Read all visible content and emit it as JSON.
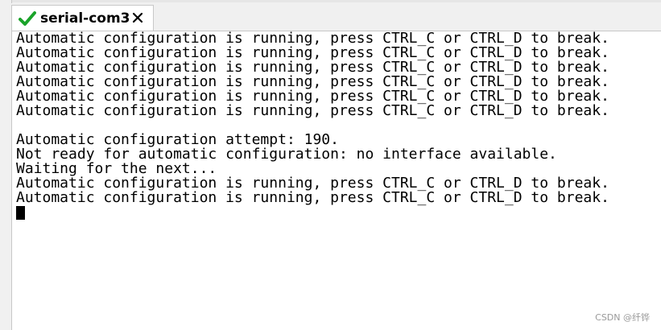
{
  "tab": {
    "title": "serial-com3",
    "status_icon": "check-icon",
    "close_icon": "close-icon",
    "status_color": "#1aa32a"
  },
  "terminal": {
    "lines": [
      "Automatic configuration is running, press CTRL_C or CTRL_D to break.",
      "Automatic configuration is running, press CTRL_C or CTRL_D to break.",
      "Automatic configuration is running, press CTRL_C or CTRL_D to break.",
      "Automatic configuration is running, press CTRL_C or CTRL_D to break.",
      "Automatic configuration is running, press CTRL_C or CTRL_D to break.",
      "Automatic configuration is running, press CTRL_C or CTRL_D to break.",
      "",
      "Automatic configuration attempt: 190.",
      "Not ready for automatic configuration: no interface available.",
      "Waiting for the next...",
      "Automatic configuration is running, press CTRL_C or CTRL_D to break.",
      "Automatic configuration is running, press CTRL_C or CTRL_D to break."
    ]
  },
  "watermark": "CSDN @纤铧"
}
